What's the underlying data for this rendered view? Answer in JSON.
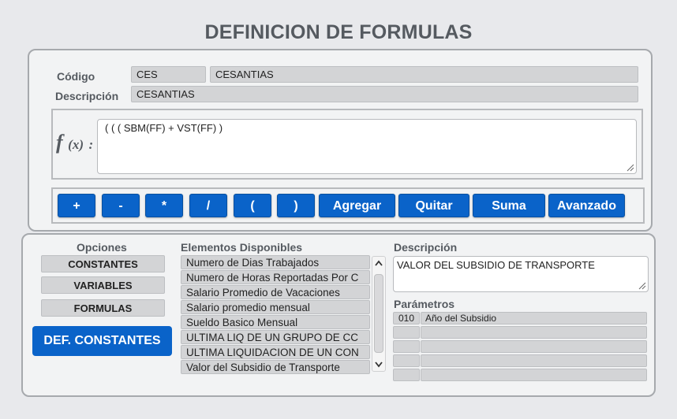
{
  "page_title": "DEFINICION DE FORMULAS",
  "header": {
    "codigo_label": "Código",
    "descripcion_label": "Descripción",
    "codigo_value": "CES",
    "codigo_name": "CESANTIAS",
    "descripcion_value": "CESANTIAS"
  },
  "formula": {
    "label_f": "f",
    "label_x": "(x)",
    "label_colon": ":",
    "value": "( ( ( SBM(FF) + VST(FF) )"
  },
  "operators": {
    "plus": "+",
    "minus": "-",
    "multiply": "*",
    "divide": "/",
    "open_paren": "(",
    "close_paren": ")",
    "agregar": "Agregar",
    "quitar": "Quitar",
    "suma": "Suma",
    "avanzado": "Avanzado"
  },
  "opciones": {
    "title": "Opciones",
    "constantes": "CONSTANTES",
    "variables": "VARIABLES",
    "formulas": "FORMULAS",
    "def_constantes": "DEF. CONSTANTES"
  },
  "elementos": {
    "title": "Elementos Disponibles",
    "items": [
      "Numero de Dias Trabajados",
      "Numero de Horas Reportadas Por C",
      "Salario Promedio de Vacaciones",
      "Salario promedio mensual",
      "Sueldo Basico Mensual",
      "ULTIMA LIQ DE UN GRUPO DE CC",
      "ULTIMA LIQUIDACION DE UN CON",
      "Valor del Subsidio de Transporte"
    ]
  },
  "descripcion": {
    "title": "Descripción",
    "value": "VALOR DEL SUBSIDIO DE TRANSPORTE"
  },
  "parametros": {
    "title": "Parámetros",
    "rows": [
      {
        "code": "010",
        "name": "Año del Subsidio"
      },
      {
        "code": "",
        "name": ""
      },
      {
        "code": "",
        "name": ""
      },
      {
        "code": "",
        "name": ""
      },
      {
        "code": "",
        "name": ""
      }
    ]
  },
  "colors": {
    "accent_blue": "#0a63c9",
    "field_gray": "#d3d4d6",
    "label_gray": "#555a60"
  }
}
